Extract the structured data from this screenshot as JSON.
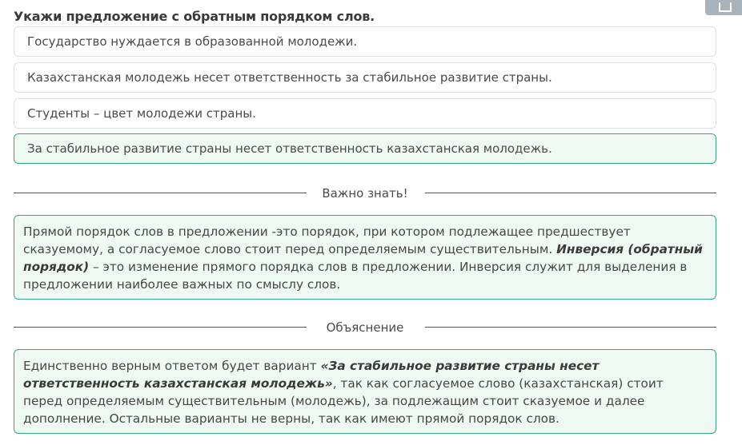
{
  "question": "Укажи предложение с обратным порядком слов.",
  "options": [
    {
      "text": "Государство нуждается в образованной молодежи."
    },
    {
      "text": "Казахстанская молодежь несет ответственность за стабильное развитие страны."
    },
    {
      "text": "Студенты – цвет молодежи страны."
    },
    {
      "text": "За стабильное развитие страны несет ответственность казахстанская молодежь."
    }
  ],
  "important": {
    "heading": "Важно знать!",
    "text_before": "Прямой порядок слов в предложении -это порядок, при котором подлежащее предшествует сказуемому, а согласуемое слово стоит перед определяемым существительным. ",
    "emphasis": "Инверсия (обратный порядок)",
    "text_after": " – это изменение прямого порядка слов в предложении. Инверсия служит для выделения в предложении наиболее важных по смыслу слов."
  },
  "explanation": {
    "heading": "Объяснение",
    "text_before": "Единственно верным ответом будет вариант ",
    "emphasis": "«За стабильное развитие страны несет ответственность казахстанская молодежь»",
    "text_after": ", так как согласуемое слово (казахстанская) стоит перед определяемым существительным (молодежь), за подлежащим стоит сказуемое и далее дополнение. Остальные варианты не верны, так как имеют прямой порядок слов."
  },
  "colors": {
    "correct_border": "#33a87e",
    "correct_bg": "#eef9f4"
  }
}
